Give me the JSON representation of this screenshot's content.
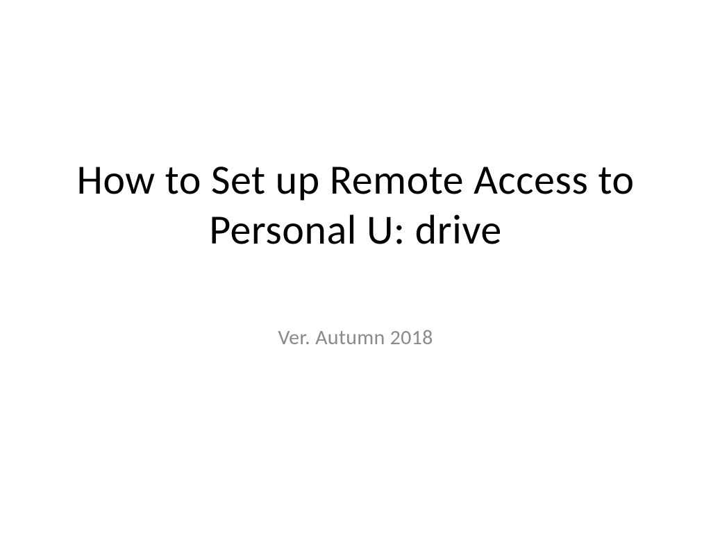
{
  "slide": {
    "title": "How to Set up Remote Access to Personal U: drive",
    "subtitle": "Ver. Autumn 2018"
  }
}
